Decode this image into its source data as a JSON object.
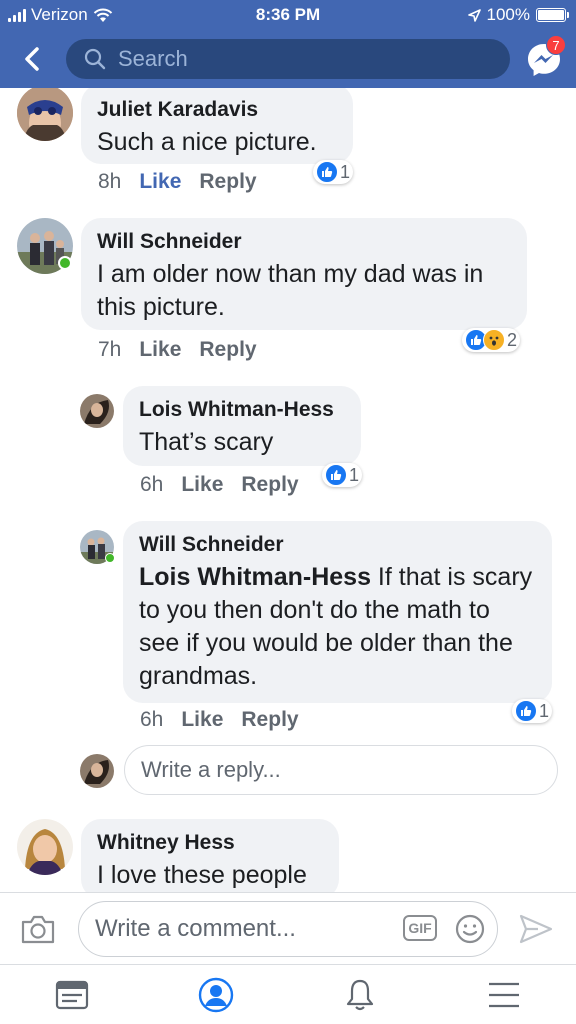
{
  "status_bar": {
    "carrier": "Verizon",
    "time": "8:36 PM",
    "battery": "100%"
  },
  "header": {
    "search_placeholder": "Search",
    "messenger_badge": "7"
  },
  "comments": [
    {
      "author": "Juliet Karadavis",
      "text": "Such a nice picture.",
      "time": "8h",
      "like_label": "Like",
      "reply_label": "Reply",
      "liked": true,
      "reaction_count": "1"
    },
    {
      "author": "Will Schneider",
      "text": "I am older now than my dad was in this picture.",
      "time": "7h",
      "like_label": "Like",
      "reply_label": "Reply",
      "reaction_count": "2"
    },
    {
      "author": "Lois Whitman-Hess",
      "text": "That’s scary",
      "time": "6h",
      "like_label": "Like",
      "reply_label": "Reply",
      "reaction_count": "1"
    },
    {
      "author": "Will Schneider",
      "mention": "Lois Whitman-Hess",
      "text": " If that is scary to you then don't do the math to see if you would be older than the grandmas.",
      "time": "6h",
      "like_label": "Like",
      "reply_label": "Reply",
      "reaction_count": "1"
    },
    {
      "author": "Whitney Hess",
      "text": "I love these people"
    }
  ],
  "reply_input": {
    "placeholder": "Write a reply..."
  },
  "composer": {
    "placeholder": "Write a comment...",
    "gif_label": "GIF"
  },
  "colors": {
    "brand": "#4267b2",
    "like_blue": "#1877f2",
    "online": "#42b72a",
    "badge": "#fa3e3e"
  }
}
